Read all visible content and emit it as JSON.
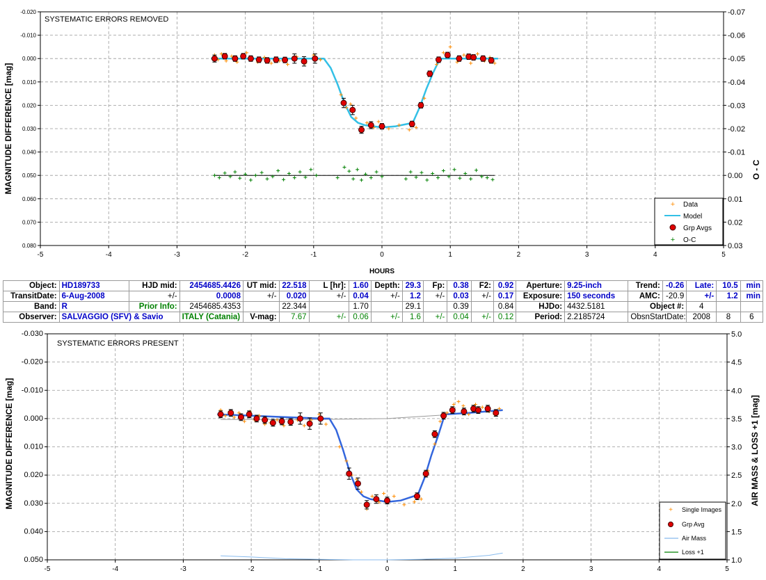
{
  "chart_data": [
    {
      "type": "scatter",
      "title": "SYSTEMATIC ERRORS REMOVED",
      "xlabel": "HOURS",
      "ylabel": "MAGNITUDE DIFFERENCE [mag]",
      "y2label": "O - C",
      "xlim": [
        -5,
        5
      ],
      "ylim": [
        -0.02,
        0.08
      ],
      "y_inverted": true,
      "y2lim": [
        -0.07,
        0.03
      ],
      "x_ticks": [
        "-5",
        "-4",
        "-3",
        "-2",
        "-1",
        "0",
        "1",
        "2",
        "3",
        "4",
        "5"
      ],
      "y_ticks": [
        "-0.020",
        "-0.010",
        "0.000",
        "0.010",
        "0.020",
        "0.030",
        "0.040",
        "0.050",
        "0.060",
        "0.070",
        "0.080"
      ],
      "y2_ticks": [
        "-0.07",
        "-0.06",
        "-0.05",
        "-0.04",
        "-0.03",
        "-0.02",
        "-0.01",
        "0.00",
        "0.01",
        "0.02",
        "0.03"
      ],
      "grid": true,
      "legend_position": "bottom-right",
      "legend": [
        "Data",
        "Model",
        "Grp Avgs",
        "O-C"
      ],
      "colors": {
        "data": "#ff8c00",
        "model": "#33c0e6",
        "grp": "#e00000",
        "oc": "#008000"
      },
      "series": [
        {
          "name": "Grp Avgs",
          "x": [
            -2.45,
            -2.3,
            -2.15,
            -2.03,
            -1.92,
            -1.8,
            -1.68,
            -1.55,
            -1.42,
            -1.28,
            -1.14,
            -0.98,
            -0.56,
            -0.43,
            -0.3,
            -0.16,
            0.0,
            0.44,
            0.57,
            0.7,
            0.83,
            0.96,
            1.13,
            1.27,
            1.34,
            1.48,
            1.6
          ],
          "y": [
            0.0,
            -0.001,
            0.0,
            -0.001,
            0.0,
            0.0005,
            0.0008,
            0.0005,
            0.0006,
            0.0,
            0.0012,
            0.0,
            0.019,
            0.022,
            0.0305,
            0.0285,
            0.029,
            0.028,
            0.02,
            0.0065,
            0.0005,
            -0.0015,
            0.0,
            -0.0008,
            -0.0005,
            0.0,
            0.0008
          ],
          "err": [
            0.0015,
            0.0012,
            0.0012,
            0.0012,
            0.0012,
            0.0012,
            0.0012,
            0.0012,
            0.0012,
            0.002,
            0.002,
            0.002,
            0.002,
            0.002,
            0.0015,
            0.0015,
            0.0012,
            0.0012,
            0.0012,
            0.0012,
            0.0012,
            0.0012,
            0.0012,
            0.0012,
            0.0012,
            0.0012,
            0.0012
          ]
        },
        {
          "name": "Model",
          "x": [
            -2.5,
            -0.95,
            -0.85,
            -0.75,
            -0.65,
            -0.55,
            -0.45,
            -0.35,
            -0.25,
            0.0,
            0.2,
            0.45,
            0.55,
            0.65,
            0.75,
            0.85,
            1.7
          ],
          "y": [
            0.0,
            0.0,
            0.0,
            0.004,
            0.011,
            0.019,
            0.025,
            0.0275,
            0.0285,
            0.0295,
            0.029,
            0.0275,
            0.021,
            0.013,
            0.006,
            0.0,
            0.0
          ]
        },
        {
          "name": "Data",
          "x": [
            -2.45,
            -2.4,
            -2.35,
            -2.28,
            -2.2,
            -2.12,
            -2.05,
            -1.98,
            -1.9,
            -1.82,
            -1.72,
            -1.62,
            -1.5,
            -1.38,
            -1.25,
            -1.12,
            -1.0,
            -0.9,
            -0.6,
            -0.52,
            -0.46,
            -0.38,
            -0.3,
            -0.22,
            -0.12,
            -0.05,
            0.1,
            0.25,
            0.4,
            0.5,
            0.62,
            0.72,
            0.8,
            0.9,
            1.0,
            1.1,
            1.2,
            1.3,
            1.4,
            1.5,
            1.58,
            1.65
          ],
          "y": [
            -0.0015,
            0.0005,
            -0.002,
            0.001,
            -0.001,
            0.0015,
            -0.0008,
            -0.0025,
            0.0005,
            0.0015,
            -0.0005,
            0.002,
            0.001,
            0.0025,
            -0.0008,
            0.002,
            -0.0015,
            0.0005,
            0.0155,
            0.021,
            0.0195,
            0.0255,
            0.031,
            0.0275,
            0.0295,
            0.027,
            0.03,
            0.0285,
            0.0305,
            0.0295,
            0.017,
            0.0065,
            0.0025,
            -0.0025,
            -0.005,
            0.0015,
            -0.0015,
            0.002,
            -0.002,
            0.001,
            -0.0005,
            0.002
          ]
        },
        {
          "name": "O-C",
          "x": [
            -2.45,
            -2.38,
            -2.3,
            -2.22,
            -2.15,
            -2.08,
            -2.0,
            -1.92,
            -1.85,
            -1.76,
            -1.68,
            -1.6,
            -1.52,
            -1.44,
            -1.36,
            -1.28,
            -1.2,
            -1.12,
            -1.04,
            -0.96,
            -0.65,
            -0.55,
            -0.48,
            -0.42,
            -0.36,
            -0.3,
            -0.24,
            -0.16,
            -0.08,
            0.0,
            0.35,
            0.42,
            0.5,
            0.58,
            0.66,
            0.74,
            0.82,
            0.9,
            0.98,
            1.06,
            1.14,
            1.22,
            1.3,
            1.38,
            1.46,
            1.54,
            1.62
          ],
          "y": [
            0.0,
            0.001,
            -0.001,
            0.0005,
            -0.0015,
            0.0012,
            -0.0005,
            0.002,
            0.0,
            -0.0012,
            0.0015,
            0.0005,
            -0.002,
            0.0018,
            -0.0008,
            0.001,
            -0.0015,
            0.0008,
            -0.0025,
            0.0,
            0.001,
            -0.0035,
            -0.0018,
            0.0015,
            -0.0025,
            0.002,
            -0.0005,
            0.001,
            -0.0015,
            0.0005,
            0.0015,
            -0.0015,
            0.0008,
            -0.0012,
            0.002,
            -0.0008,
            0.001,
            -0.002,
            0.0005,
            -0.0025,
            0.0012,
            -0.0008,
            0.0015,
            -0.0022,
            0.0005,
            0.001,
            0.0018
          ]
        }
      ]
    },
    {
      "type": "scatter",
      "title": "SYSTEMATIC ERRORS PRESENT",
      "ylabel": "MAGNITUDE DIFFERENCE [mag]",
      "y2label": "AIR MASS & LOSS +1 [mag]",
      "xlim": [
        -5,
        5
      ],
      "ylim": [
        -0.03,
        0.05
      ],
      "y_inverted": true,
      "y2lim": [
        1.0,
        5.0
      ],
      "x_ticks": [
        "-5",
        "-4",
        "-3",
        "-2",
        "-1",
        "0",
        "1",
        "2",
        "3",
        "4",
        "5"
      ],
      "y_ticks": [
        "-0.030",
        "-0.020",
        "-0.010",
        "0.000",
        "0.010",
        "0.020",
        "0.030",
        "0.040",
        "0.050"
      ],
      "y2_ticks": [
        "5.0",
        "4.5",
        "4.0",
        "3.5",
        "3.0",
        "2.5",
        "2.0",
        "1.5",
        "1.0"
      ],
      "grid": true,
      "legend_position": "bottom-right",
      "legend": [
        "Single Images",
        "Grp Avg",
        "Air Mass",
        "Loss +1"
      ],
      "colors": {
        "data": "#ff8c00",
        "model": "#3366dd",
        "grp": "#e00000",
        "airmass": "#88bbee",
        "loss": "#008000",
        "trend": "#999999"
      },
      "series": [
        {
          "name": "Grp Avg",
          "x": [
            -2.45,
            -2.3,
            -2.15,
            -2.03,
            -1.92,
            -1.8,
            -1.68,
            -1.55,
            -1.42,
            -1.28,
            -1.14,
            -0.98,
            -0.56,
            -0.43,
            -0.3,
            -0.16,
            0.0,
            0.44,
            0.57,
            0.7,
            0.83,
            0.96,
            1.13,
            1.27,
            1.34,
            1.48,
            1.6
          ],
          "y": [
            -0.0015,
            -0.002,
            -0.0005,
            -0.0015,
            0.0,
            0.0005,
            0.0015,
            0.001,
            0.0012,
            0.0,
            0.0018,
            0.0,
            0.0195,
            0.023,
            0.0305,
            0.0285,
            0.029,
            0.0275,
            0.0195,
            0.0055,
            -0.001,
            -0.003,
            -0.0025,
            -0.0035,
            -0.003,
            -0.0035,
            -0.002
          ],
          "err": [
            0.0012,
            0.0012,
            0.0012,
            0.0012,
            0.0012,
            0.0012,
            0.0012,
            0.0012,
            0.0012,
            0.002,
            0.002,
            0.002,
            0.002,
            0.002,
            0.0015,
            0.0015,
            0.0012,
            0.0012,
            0.0012,
            0.0012,
            0.0012,
            0.0012,
            0.0012,
            0.0012,
            0.0012,
            0.0012,
            0.0012
          ]
        },
        {
          "name": "Model",
          "x": [
            -2.5,
            -0.95,
            -0.85,
            -0.75,
            -0.65,
            -0.55,
            -0.45,
            -0.35,
            -0.25,
            0.0,
            0.2,
            0.45,
            0.55,
            0.65,
            0.75,
            0.85,
            1.2,
            1.7
          ],
          "y": [
            -0.0015,
            0.0,
            0.0,
            0.004,
            0.011,
            0.019,
            0.025,
            0.0275,
            0.0285,
            0.0295,
            0.029,
            0.027,
            0.021,
            0.013,
            0.006,
            -0.0015,
            -0.002,
            -0.003
          ]
        },
        {
          "name": "Single Images",
          "x": [
            -2.45,
            -2.38,
            -2.32,
            -2.25,
            -2.18,
            -2.1,
            -2.02,
            -1.95,
            -1.88,
            -1.8,
            -1.72,
            -1.62,
            -1.52,
            -1.42,
            -1.32,
            -1.22,
            -1.12,
            -1.0,
            -0.9,
            -0.7,
            -0.6,
            -0.52,
            -0.45,
            -0.38,
            -0.3,
            -0.22,
            -0.12,
            -0.05,
            0.1,
            0.25,
            0.4,
            0.5,
            0.6,
            0.7,
            0.78,
            0.88,
            0.98,
            1.05,
            1.12,
            1.2,
            1.3,
            1.4,
            1.5,
            1.58,
            1.65
          ],
          "y": [
            -0.003,
            -0.001,
            -0.0025,
            -0.0005,
            -0.002,
            0.001,
            -0.0025,
            0.0005,
            -0.001,
            0.002,
            0.0015,
            0.0005,
            0.0025,
            0.001,
            0.0005,
            0.0025,
            0.0005,
            -0.0015,
            0.002,
            0.01,
            0.015,
            0.02,
            0.0215,
            0.026,
            0.032,
            0.0275,
            0.0295,
            0.0265,
            0.0275,
            0.0305,
            0.0295,
            0.0285,
            0.0185,
            0.009,
            0.001,
            -0.002,
            -0.005,
            -0.006,
            -0.0045,
            -0.0015,
            -0.005,
            -0.004,
            -0.0025,
            -0.0015,
            -0.0035
          ]
        },
        {
          "name": "Air Mass",
          "x": [
            -2.45,
            -2.0,
            -1.5,
            -1.0,
            -0.5,
            0.0,
            0.5,
            1.0,
            1.5,
            1.7
          ],
          "y": [
            1.07,
            1.05,
            1.02,
            1.01,
            1.0,
            1.0,
            1.01,
            1.03,
            1.08,
            1.12
          ]
        },
        {
          "name": "Trend",
          "x": [
            -2.45,
            -1.0,
            0.0,
            1.0,
            1.7
          ],
          "y": [
            0.0003,
            0.0003,
            0.0,
            -0.0015,
            -0.003
          ]
        }
      ]
    }
  ],
  "info": {
    "r1": [
      "Object:",
      "HD189733",
      "HJD mid:",
      "2454685.4426",
      "UT mid:",
      "22.518",
      "L [hr]:",
      "1.60",
      "Depth:",
      "29.3",
      "Fp:",
      "0.38",
      "F2:",
      "0.92",
      "Aperture:",
      "9.25-inch",
      "Trend:",
      "-0.26",
      "Late:",
      "10.5",
      "min"
    ],
    "r2": [
      "TransitDate:",
      "6-Aug-2008",
      "+/-",
      "0.0008",
      "+/-",
      "0.020",
      "+/-",
      "0.04",
      "+/-",
      "1.2",
      "+/-",
      "0.03",
      "+/-",
      "0.17",
      "Exposure:",
      "150 seconds",
      "AMC:",
      "-20.9",
      "+/-",
      "1.2",
      "min"
    ],
    "r3": [
      "Band:",
      "R",
      "Prior Info:",
      "2454685.4353",
      "22.344",
      "1.70",
      "29.1",
      "0.39",
      "0.84",
      "HJDo:",
      "4432.5181",
      "Object #:",
      "4"
    ],
    "r4": [
      "Observer:",
      "SALVAGGIO (SFV) & Savio",
      "ITALY (Catania)",
      "V-mag:",
      "7.67",
      "+/-",
      "0.06",
      "+/-",
      "1.6",
      "+/-",
      "0.04",
      "+/-",
      "0.12",
      "Period:",
      "2.2185724",
      "ObsnStartDate:",
      "2008",
      "8",
      "6"
    ]
  }
}
